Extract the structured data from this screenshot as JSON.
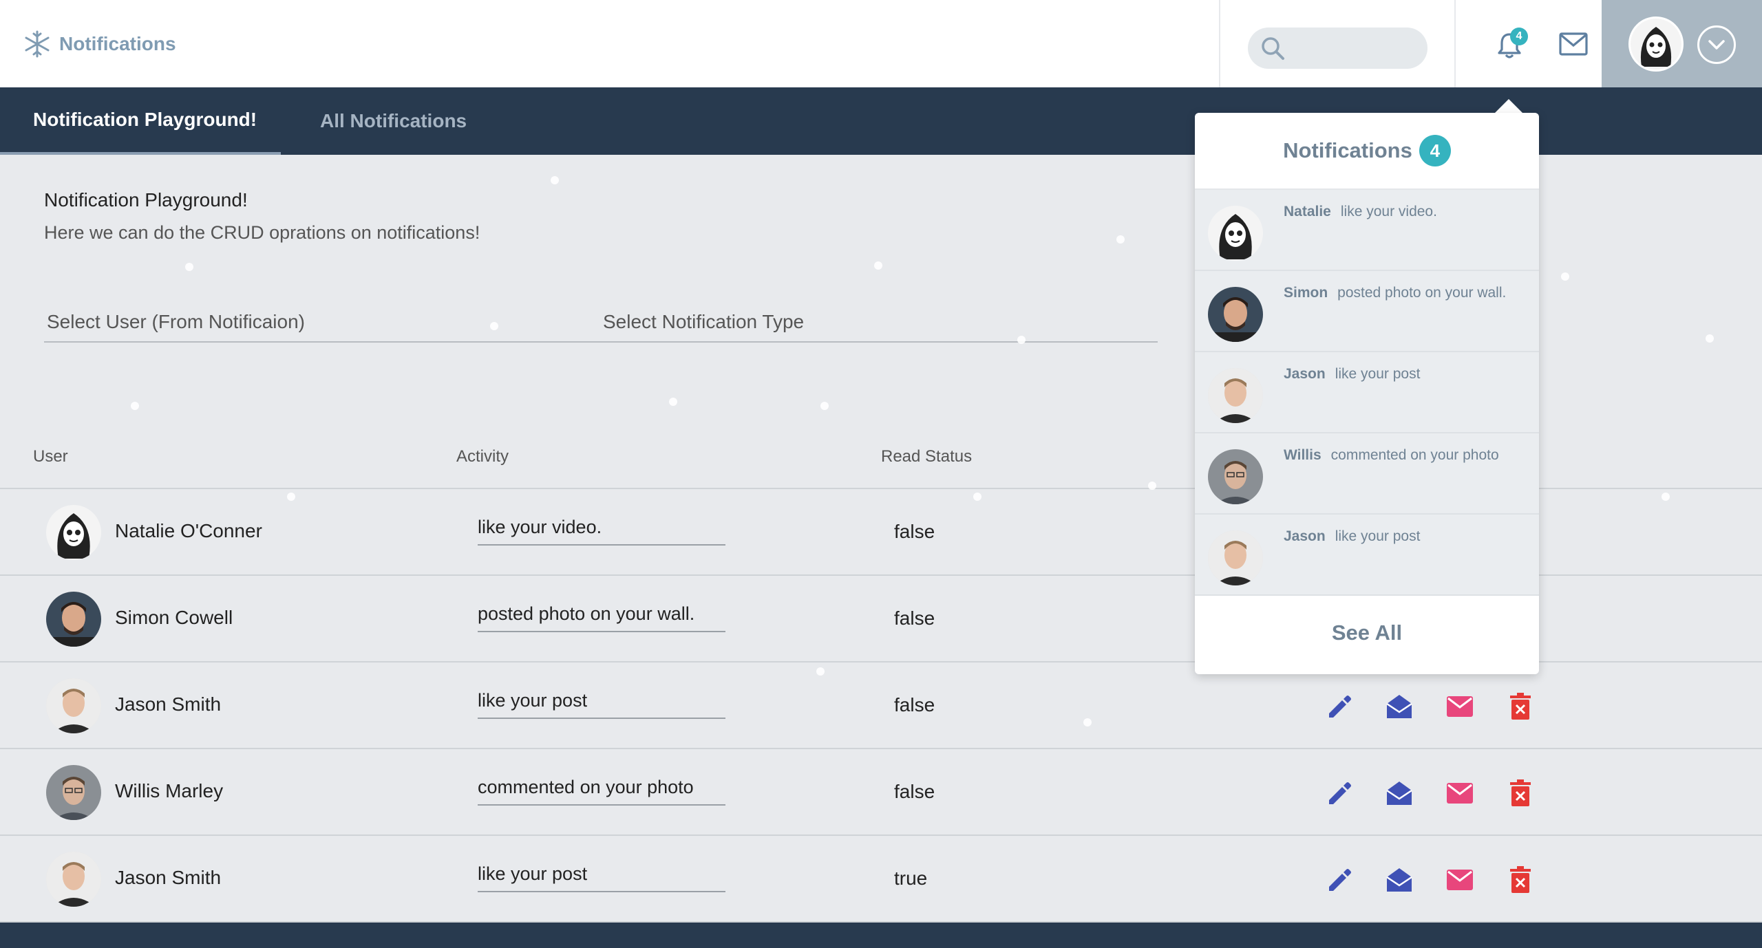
{
  "header": {
    "brand": "Notifications",
    "search_placeholder": "",
    "bell_count": "4"
  },
  "tabs": [
    {
      "label": "Notification Playground!",
      "active": true
    },
    {
      "label": "All Notifications",
      "active": false
    }
  ],
  "intro": {
    "title": "Notification Playground!",
    "subtitle": "Here we can do the CRUD oprations on notifications!"
  },
  "filters": {
    "user_label": "Select User (From Notificaion)",
    "type_label": "Select Notification Type"
  },
  "table": {
    "columns": [
      "User",
      "Activity",
      "Read Status"
    ],
    "rows": [
      {
        "name": "Natalie O'Conner",
        "activity": "like your video.",
        "status": "false"
      },
      {
        "name": "Simon Cowell",
        "activity": "posted photo on your wall.",
        "status": "false"
      },
      {
        "name": "Jason Smith",
        "activity": "like your post",
        "status": "false"
      },
      {
        "name": "Willis Marley",
        "activity": "commented on your photo",
        "status": "false"
      },
      {
        "name": "Jason Smith",
        "activity": "like your post",
        "status": "true"
      }
    ]
  },
  "dropdown": {
    "title": "Notifications",
    "count": "4",
    "items": [
      {
        "name": "Natalie",
        "text": "like your video."
      },
      {
        "name": "Simon",
        "text": "posted photo on your wall."
      },
      {
        "name": "Jason",
        "text": "like your post"
      },
      {
        "name": "Willis",
        "text": "commented on your photo"
      },
      {
        "name": "Jason",
        "text": "like your post"
      }
    ],
    "see_all": "See All"
  },
  "colors": {
    "navy": "#283a4f",
    "teal_badge": "#35b3bf",
    "edit_blue": "#3f51b5",
    "mail_pink": "#e8467c",
    "delete_red": "#e53935"
  }
}
